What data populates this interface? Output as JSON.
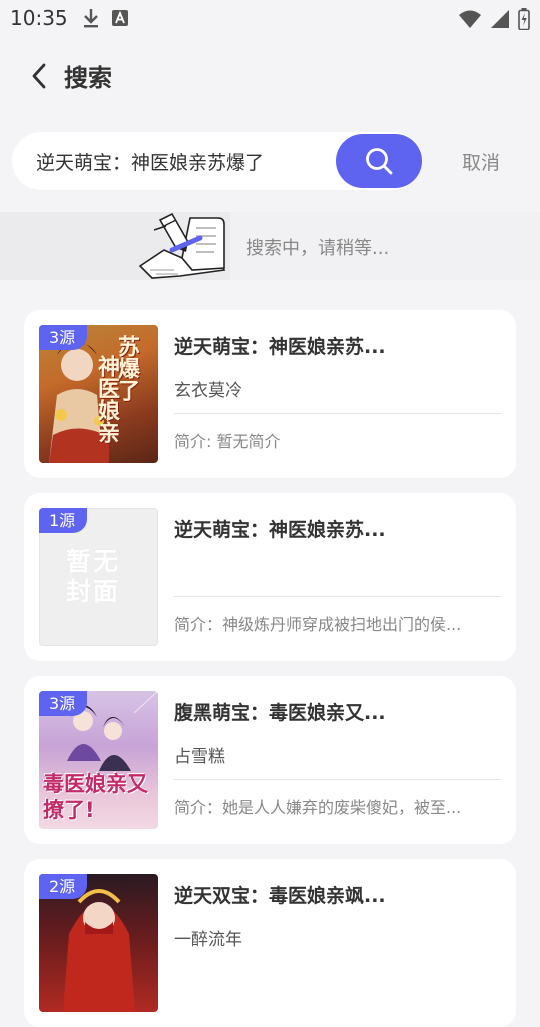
{
  "status_bar": {
    "time": "10:35",
    "icons": [
      "download-icon",
      "text-a-icon",
      "wifi-icon",
      "signal-icon",
      "battery-charging-icon"
    ]
  },
  "header": {
    "title": "搜索"
  },
  "search": {
    "query": "逆天萌宝：神医娘亲苏爆了",
    "cancel_label": "取消"
  },
  "loading": {
    "text": "搜索中，请稍等..."
  },
  "results": [
    {
      "source_count": "3源",
      "title": "逆天萌宝：神医娘亲苏...",
      "author": "玄衣莫冷",
      "intro": "简介: 暂无简介",
      "cover": "illustrated",
      "cover_text": "神医娘亲苏爆了"
    },
    {
      "source_count": "1源",
      "title": "逆天萌宝：神医娘亲苏...",
      "author": "",
      "intro": "简介：神级炼丹师穿成被扫地出门的侯...",
      "cover": "placeholder",
      "cover_text": "暂无封面"
    },
    {
      "source_count": "3源",
      "title": "腹黑萌宝：毒医娘亲又...",
      "author": "占雪糕",
      "intro": "简介：她是人人嫌弃的废柴傻妃，被至...",
      "cover": "illustrated",
      "cover_text": "毒医娘亲又撩了"
    },
    {
      "source_count": "2源",
      "title": "逆天双宝：毒医娘亲飒...",
      "author": "一醉流年",
      "intro": "",
      "cover": "illustrated",
      "cover_text": ""
    }
  ],
  "colors": {
    "accent": "#5e63f0",
    "background": "#f4f4f6",
    "card": "#ffffff"
  }
}
